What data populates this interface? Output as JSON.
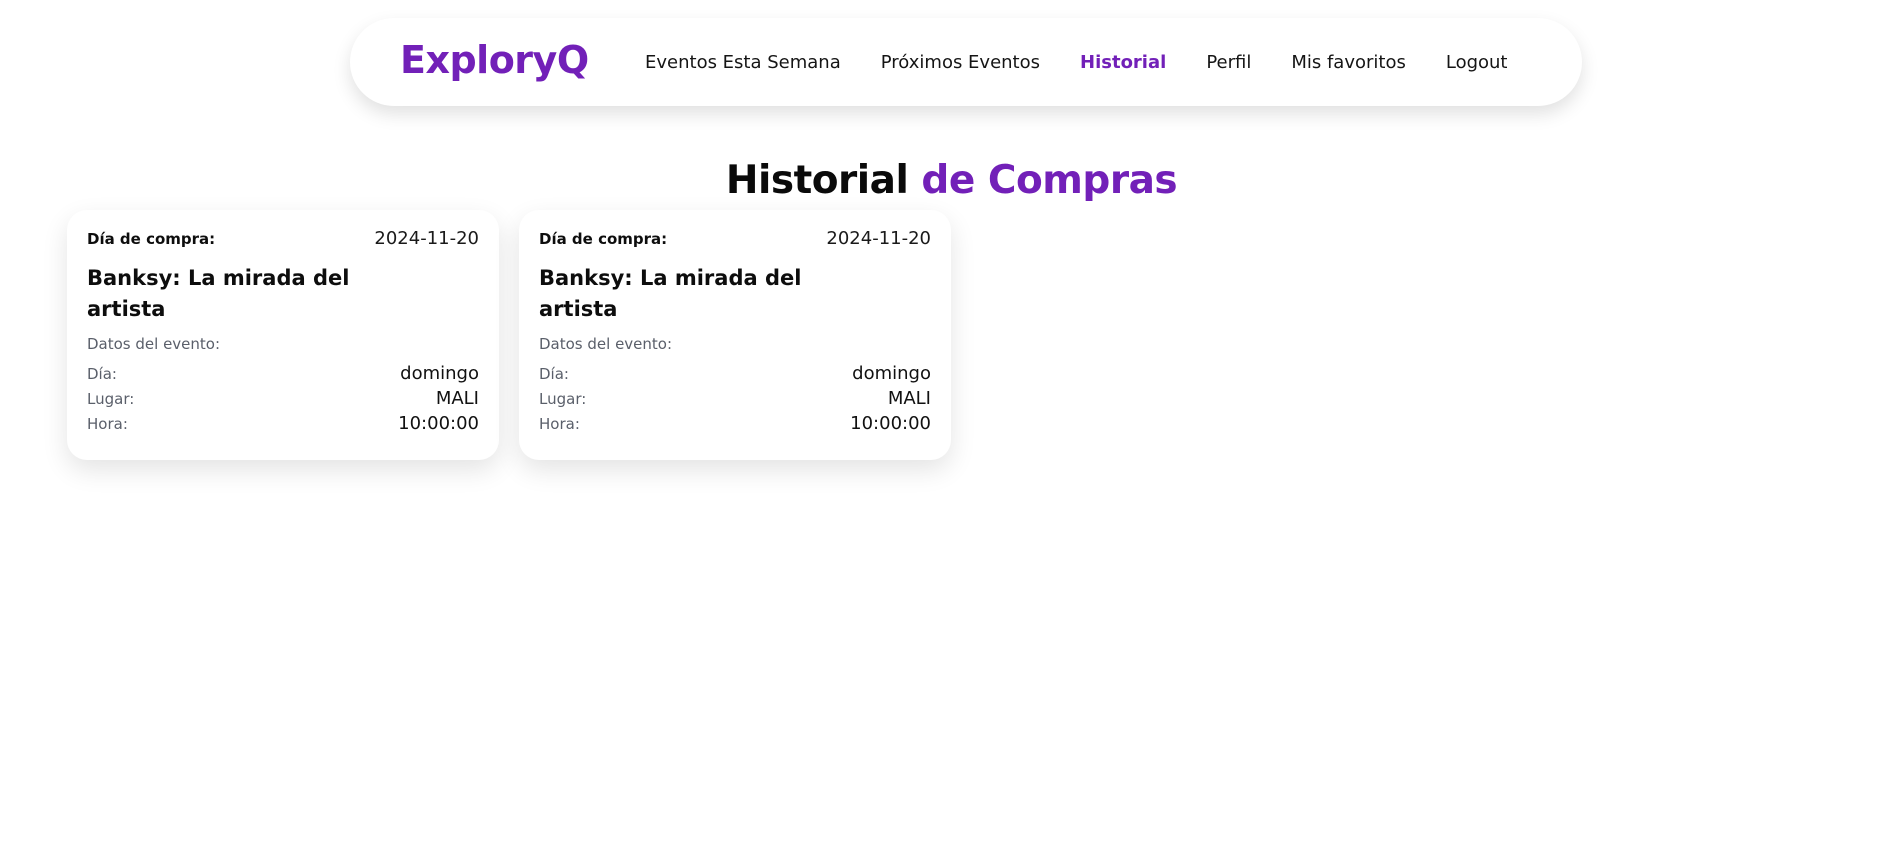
{
  "brand": {
    "logo": "ExploryQ",
    "accent_color": "#7220b8"
  },
  "nav": {
    "items": [
      {
        "label": "Eventos Esta Semana",
        "active": false
      },
      {
        "label": "Próximos Eventos",
        "active": false
      },
      {
        "label": "Historial",
        "active": true
      },
      {
        "label": "Perfil",
        "active": false
      },
      {
        "label": "Mis favoritos",
        "active": false
      },
      {
        "label": "Logout",
        "active": false
      }
    ]
  },
  "page": {
    "title_part1": "Historial",
    "title_part2": "de Compras"
  },
  "purchases": [
    {
      "purchase_label": "Día de compra:",
      "purchase_date": "2024-11-20",
      "event_title": "Banksy: La mirada del artista",
      "section_label": "Datos del evento:",
      "day_label": "Día:",
      "day_value": "domingo",
      "place_label": "Lugar:",
      "place_value": "MALI",
      "time_label": "Hora:",
      "time_value": "10:00:00"
    },
    {
      "purchase_label": "Día de compra:",
      "purchase_date": "2024-11-20",
      "event_title": "Banksy: La mirada del artista",
      "section_label": "Datos del evento:",
      "day_label": "Día:",
      "day_value": "domingo",
      "place_label": "Lugar:",
      "place_value": "MALI",
      "time_label": "Hora:",
      "time_value": "10:00:00"
    }
  ]
}
